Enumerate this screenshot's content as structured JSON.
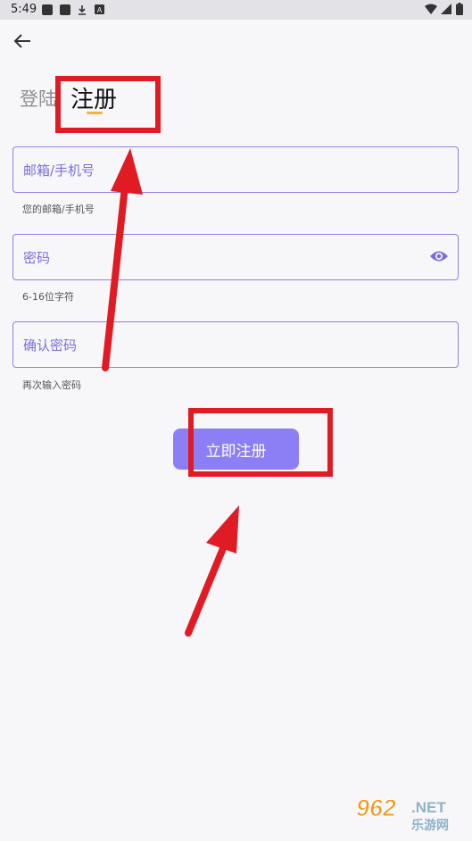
{
  "status_bar": {
    "time": "5:49",
    "icons": [
      "app-icon",
      "app-icon",
      "download-icon",
      "a-icon",
      "wifi-icon",
      "signal-icon",
      "battery-icon"
    ]
  },
  "header": {
    "back_icon": "arrow-left-icon"
  },
  "tabs": {
    "login": "登陆",
    "register": "注册",
    "active": "register"
  },
  "form": {
    "email": {
      "label": "邮箱/手机号",
      "helper": "您的邮箱/手机号"
    },
    "password": {
      "label": "密码",
      "helper": "6-16位字符",
      "toggle_icon": "eye-icon"
    },
    "confirm": {
      "label": "确认密码",
      "helper": "再次输入密码"
    }
  },
  "submit_label": "立即注册",
  "colors": {
    "accent": "#8c7ef5",
    "field_border": "#8b82e6",
    "indicator": "#f5b042",
    "annotation": "#e01b24"
  },
  "watermark": {
    "logo": "962",
    "logo_suffix": ".NET",
    "text": "乐游网"
  }
}
